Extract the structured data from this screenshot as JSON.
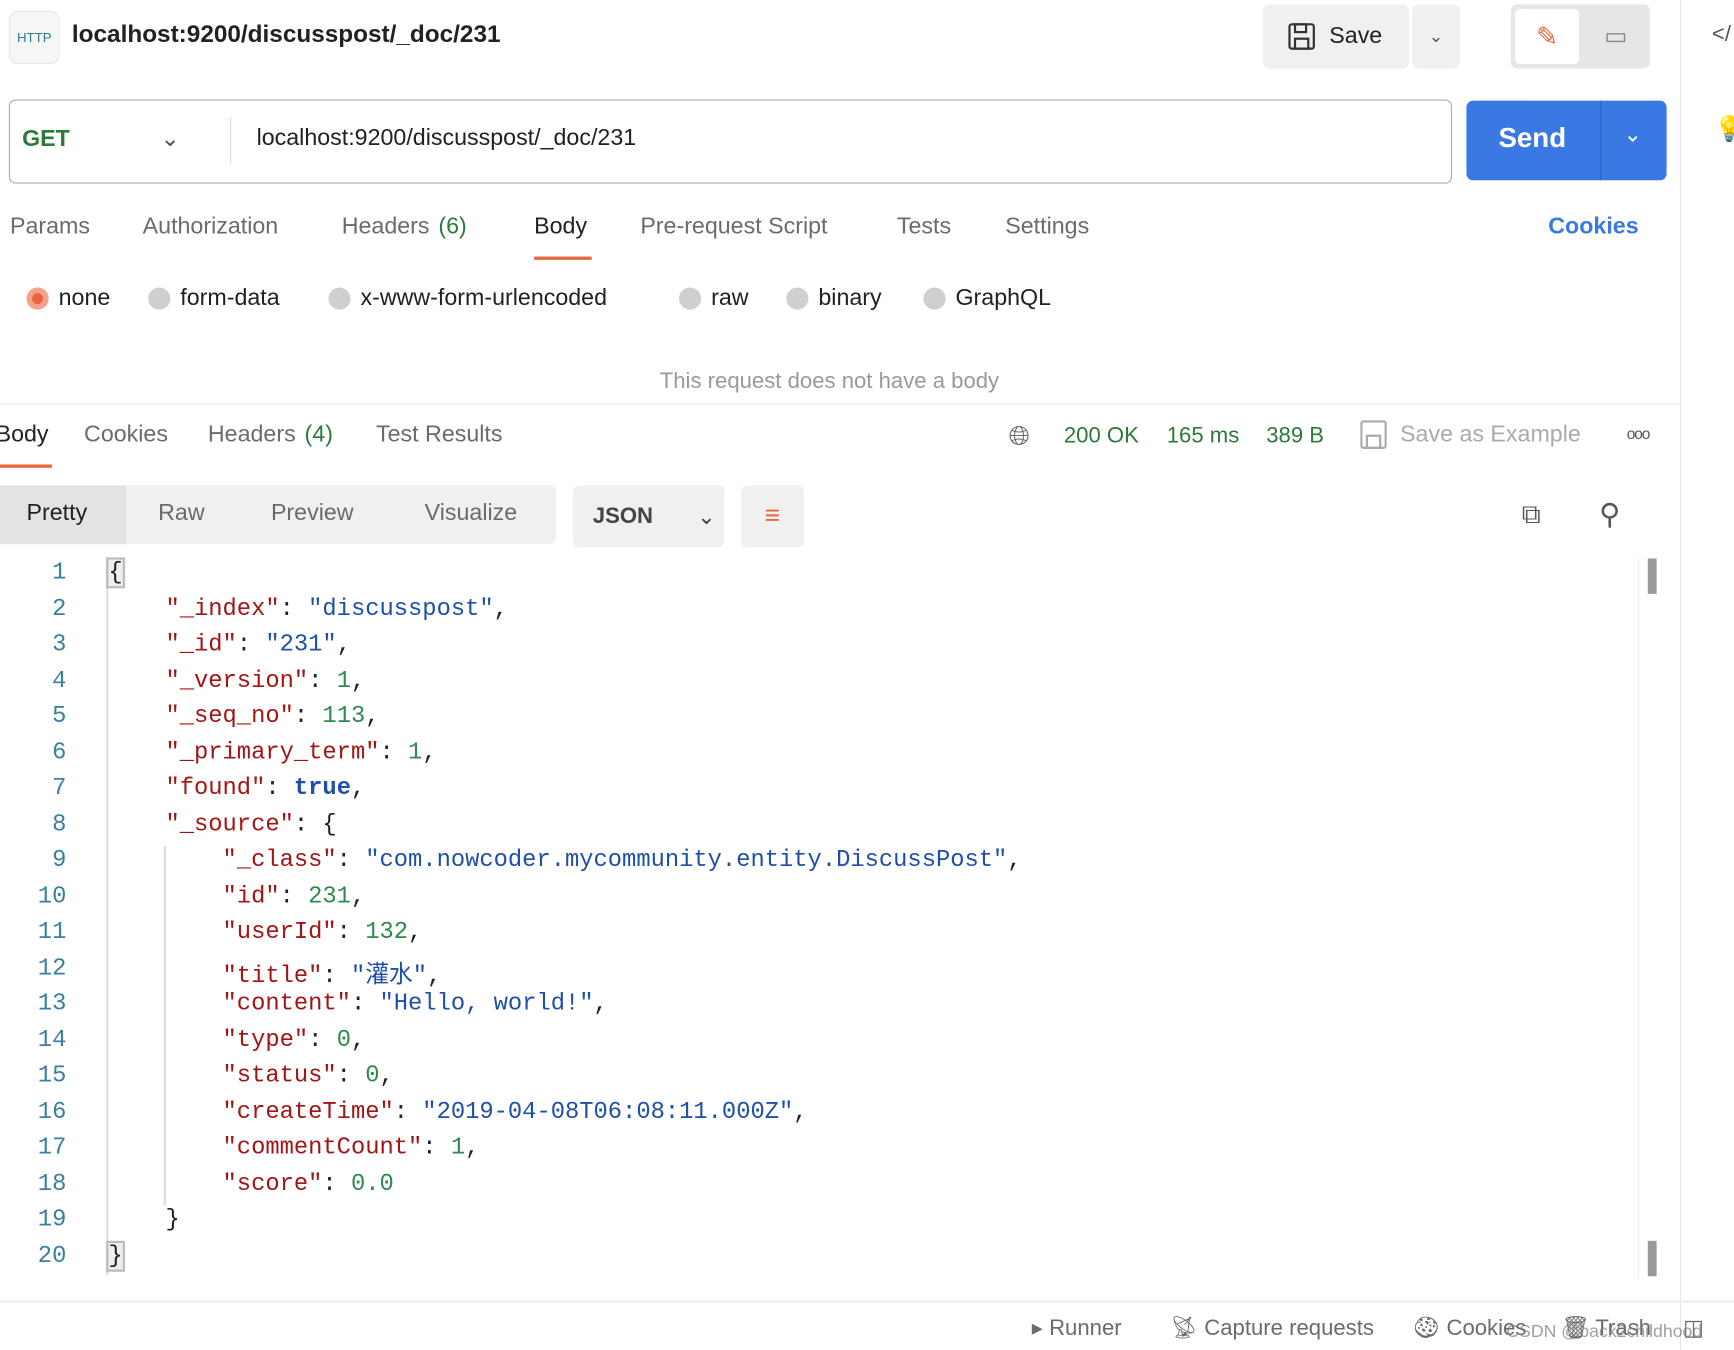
{
  "header": {
    "icon_label": "HTTP",
    "title": "localhost:9200/discusspost/_doc/231",
    "save_label": "Save"
  },
  "request": {
    "method": "GET",
    "url": "localhost:9200/discusspost/_doc/231",
    "send_label": "Send"
  },
  "request_tabs": [
    {
      "label": "Params"
    },
    {
      "label": "Authorization"
    },
    {
      "label": "Headers",
      "count": "(6)"
    },
    {
      "label": "Body",
      "active": true
    },
    {
      "label": "Pre-request Script"
    },
    {
      "label": "Tests"
    },
    {
      "label": "Settings"
    }
  ],
  "cookies_link": "Cookies",
  "body_types": [
    {
      "label": "none",
      "selected": true
    },
    {
      "label": "form-data"
    },
    {
      "label": "x-www-form-urlencoded"
    },
    {
      "label": "raw"
    },
    {
      "label": "binary"
    },
    {
      "label": "GraphQL"
    }
  ],
  "no_body_message": "This request does not have a body",
  "response_tabs": [
    {
      "label": "Body",
      "active": true
    },
    {
      "label": "Cookies"
    },
    {
      "label": "Headers",
      "count": "(4)"
    },
    {
      "label": "Test Results"
    }
  ],
  "response_meta": {
    "status": "200 OK",
    "time": "165 ms",
    "size": "389 B",
    "save_example": "Save as Example"
  },
  "view_modes": [
    "Pretty",
    "Raw",
    "Preview",
    "Visualize"
  ],
  "format": "JSON",
  "code_lines": [
    [
      [
        "p",
        "{"
      ]
    ],
    [
      [
        "i",
        1
      ],
      [
        "k",
        "\"_index\""
      ],
      [
        "p",
        ": "
      ],
      [
        "s",
        "\"discusspost\""
      ],
      [
        "p",
        ","
      ]
    ],
    [
      [
        "i",
        1
      ],
      [
        "k",
        "\"_id\""
      ],
      [
        "p",
        ": "
      ],
      [
        "s",
        "\"231\""
      ],
      [
        "p",
        ","
      ]
    ],
    [
      [
        "i",
        1
      ],
      [
        "k",
        "\"_version\""
      ],
      [
        "p",
        ": "
      ],
      [
        "n",
        "1"
      ],
      [
        "p",
        ","
      ]
    ],
    [
      [
        "i",
        1
      ],
      [
        "k",
        "\"_seq_no\""
      ],
      [
        "p",
        ": "
      ],
      [
        "n",
        "113"
      ],
      [
        "p",
        ","
      ]
    ],
    [
      [
        "i",
        1
      ],
      [
        "k",
        "\"_primary_term\""
      ],
      [
        "p",
        ": "
      ],
      [
        "n",
        "1"
      ],
      [
        "p",
        ","
      ]
    ],
    [
      [
        "i",
        1
      ],
      [
        "k",
        "\"found\""
      ],
      [
        "p",
        ": "
      ],
      [
        "b",
        "true"
      ],
      [
        "p",
        ","
      ]
    ],
    [
      [
        "i",
        1
      ],
      [
        "k",
        "\"_source\""
      ],
      [
        "p",
        ": {"
      ]
    ],
    [
      [
        "i",
        2
      ],
      [
        "k",
        "\"_class\""
      ],
      [
        "p",
        ": "
      ],
      [
        "s",
        "\"com.nowcoder.mycommunity.entity.DiscussPost\""
      ],
      [
        "p",
        ","
      ]
    ],
    [
      [
        "i",
        2
      ],
      [
        "k",
        "\"id\""
      ],
      [
        "p",
        ": "
      ],
      [
        "n",
        "231"
      ],
      [
        "p",
        ","
      ]
    ],
    [
      [
        "i",
        2
      ],
      [
        "k",
        "\"userId\""
      ],
      [
        "p",
        ": "
      ],
      [
        "n",
        "132"
      ],
      [
        "p",
        ","
      ]
    ],
    [
      [
        "i",
        2
      ],
      [
        "k",
        "\"title\""
      ],
      [
        "p",
        ": "
      ],
      [
        "s",
        "\"灌水\""
      ],
      [
        "p",
        ","
      ]
    ],
    [
      [
        "i",
        2
      ],
      [
        "k",
        "\"content\""
      ],
      [
        "p",
        ": "
      ],
      [
        "s",
        "\"Hello, world!\""
      ],
      [
        "p",
        ","
      ]
    ],
    [
      [
        "i",
        2
      ],
      [
        "k",
        "\"type\""
      ],
      [
        "p",
        ": "
      ],
      [
        "n",
        "0"
      ],
      [
        "p",
        ","
      ]
    ],
    [
      [
        "i",
        2
      ],
      [
        "k",
        "\"status\""
      ],
      [
        "p",
        ": "
      ],
      [
        "n",
        "0"
      ],
      [
        "p",
        ","
      ]
    ],
    [
      [
        "i",
        2
      ],
      [
        "k",
        "\"createTime\""
      ],
      [
        "p",
        ": "
      ],
      [
        "s",
        "\"2019-04-08T06:08:11.000Z\""
      ],
      [
        "p",
        ","
      ]
    ],
    [
      [
        "i",
        2
      ],
      [
        "k",
        "\"commentCount\""
      ],
      [
        "p",
        ": "
      ],
      [
        "n",
        "1"
      ],
      [
        "p",
        ","
      ]
    ],
    [
      [
        "i",
        2
      ],
      [
        "k",
        "\"score\""
      ],
      [
        "p",
        ": "
      ],
      [
        "n",
        "0.0"
      ]
    ],
    [
      [
        "i",
        1
      ],
      [
        "p",
        "}"
      ]
    ],
    [
      [
        "p",
        "}"
      ]
    ]
  ],
  "footer": {
    "runner": "Runner",
    "capture": "Capture requests",
    "cookies": "Cookies",
    "trash": "Trash",
    "watermark": "CSDN @back2childhood"
  },
  "colors": {
    "accent": "#3a79e3",
    "tab_underline": "#e8663d",
    "status_green": "#2c7a3a"
  }
}
